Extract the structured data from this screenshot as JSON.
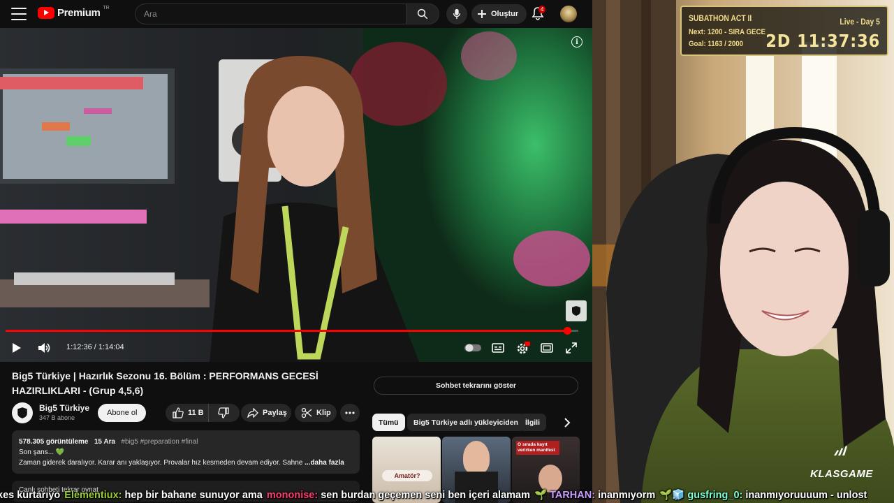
{
  "yt": {
    "logo_word": "Premium",
    "logo_country": "TR",
    "search_placeholder": "Ara",
    "create_label": "Oluştur",
    "notif_count": "4",
    "player": {
      "time": "1:12:36 / 1:14:04",
      "progress": 0.98,
      "info_glyph": "i"
    },
    "title": "Big5 Türkiye | Hazırlık Sezonu 16. Bölüm : PERFORMANS GECESİ HAZIRLIKLARI - (Grup 4,5,6)",
    "channel": {
      "name": "Big5 Türkiye",
      "subs": "347 B abone"
    },
    "subscribe_label": "Abone ol",
    "likes": "11 B",
    "share_label": "Paylaş",
    "clip_label": "Klip",
    "description": {
      "views": "578.305 görüntüleme",
      "date": "15 Ara",
      "tags": "#big5 #preparation #final",
      "line1": "Son şans... 💚",
      "line2": "Zaman giderek daralıyor. Karar anı yaklaşıyor. Provalar hız kesmeden devam ediyor. Sahne",
      "more": "...daha fazla"
    },
    "chat_replay_stub": "Canlı sohbeti tekrar oynat",
    "replay_button": "Sohbet tekrarını göster",
    "chips": [
      "Tümü",
      "Big5 Türkiye adlı yükleyiciden",
      "İlgili"
    ],
    "thumbs": [
      {
        "text": "Amatör?"
      },
      {
        "text": ""
      },
      {
        "text": "O sırada kayıt verirken manifest"
      }
    ]
  },
  "overlay": {
    "title": "SUBATHON ACT II",
    "live": "Live - Day 5",
    "next": "Next: 1200 - SIRA GECE",
    "goal": "Goal: 1163 / 2000",
    "timer": "2D 11:37:36",
    "brand": "KLASGAME"
  },
  "chat": [
    {
      "user": "",
      "msg": "kes kurtarıyo",
      "color": "#ffffff"
    },
    {
      "user": "Elementiux:",
      "msg": "hep bir bahane sunuyor ama",
      "color": "#9acd32"
    },
    {
      "user": "mononise:",
      "msg": "sen burdan geçemen seni ben içeri alamam",
      "color": "#ff3c6e"
    },
    {
      "user": "🌱 TARHAN:",
      "msg": "inanmıyorm",
      "color": "#c99cff"
    },
    {
      "user": "🌱🧊 gusfring_0:",
      "msg": "inanmıyoruuuum - unlost",
      "color": "#7fffd4"
    }
  ],
  "colors": {
    "accent_red": "#ff0000",
    "overlay_gold": "#f0dc8a"
  }
}
